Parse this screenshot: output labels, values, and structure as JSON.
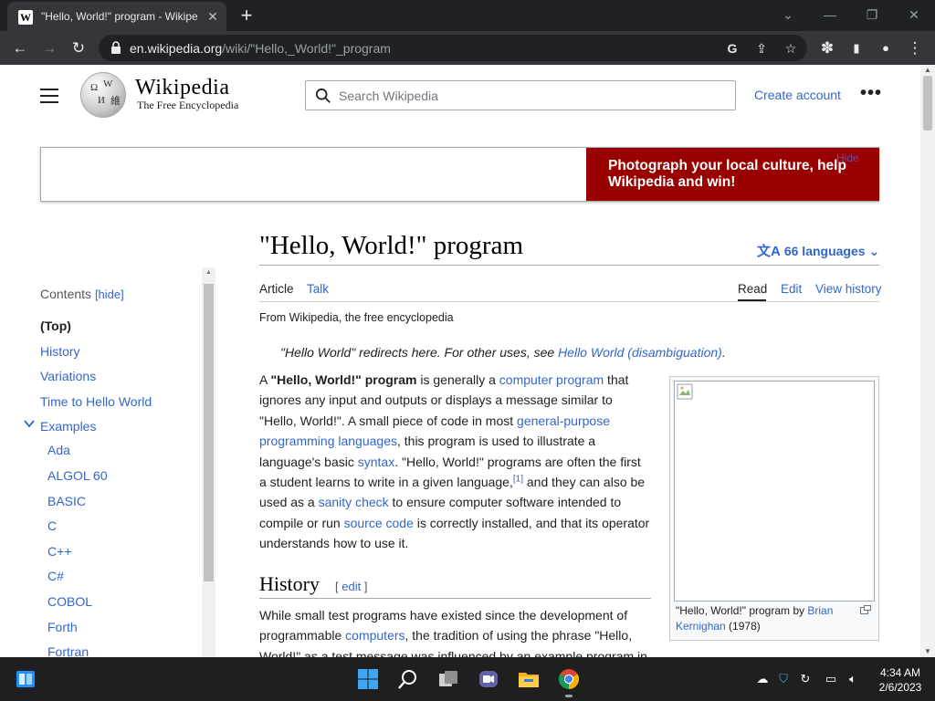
{
  "browser": {
    "tab_title": "\"Hello, World!\" program - Wikipe",
    "tab_favicon": "W",
    "url_host": "en.wikipedia.org",
    "url_path": "/wiki/\"Hello,_World!\"_program"
  },
  "icons": {
    "back": "←",
    "forward": "→",
    "reload": "↻",
    "new_tab": "+",
    "close_tab": "✕",
    "minimize": "—",
    "restore": "❐",
    "close_window": "✕",
    "tab_search": "⌄",
    "share": "⇪",
    "bookmark": "☆",
    "extensions": "✽",
    "side_panel": "▮",
    "profile": "●",
    "menu": "⋮",
    "google_lens": "G"
  },
  "wiki_header": {
    "wordmark": "Wikipedia",
    "tagline": "The Free Encyclopedia",
    "search_placeholder": "Search Wikipedia",
    "create_account": "Create account",
    "more": "•••"
  },
  "banner": {
    "text": "Photograph your local culture, help Wikipedia and win!",
    "hide": "Hide"
  },
  "toc": {
    "title": "Contents",
    "hide": "[hide]",
    "items": [
      {
        "label": "(Top)"
      },
      {
        "label": "History"
      },
      {
        "label": "Variations"
      },
      {
        "label": "Time to Hello World"
      },
      {
        "label": "Examples"
      },
      {
        "label": "Ada"
      },
      {
        "label": "ALGOL 60"
      },
      {
        "label": "BASIC"
      },
      {
        "label": "C"
      },
      {
        "label": "C++"
      },
      {
        "label": "C#"
      },
      {
        "label": "COBOL"
      },
      {
        "label": "Forth"
      },
      {
        "label": "Fortran"
      }
    ]
  },
  "article": {
    "title": "\"Hello, World!\" program",
    "languages": "66 languages",
    "tabs": {
      "article": "Article",
      "talk": "Talk",
      "read": "Read",
      "edit": "Edit",
      "history": "View history"
    },
    "from": "From Wikipedia, the free encyclopedia",
    "hatnote_text": "\"Hello World\" redirects here. For other uses, see ",
    "hatnote_link": "Hello World (disambiguation)",
    "hatnote_end": ".",
    "p1": {
      "a": "A ",
      "b": "\"Hello, World!\" program",
      "c": " is generally a ",
      "link1": "computer program",
      "d": " that",
      "l2": "ignores any input and outputs or displays a message similar to",
      "l3a": "\"Hello, World!\". A small piece of code in most ",
      "link2a": "general-purpose",
      "link2b": "programming languages",
      "l4b": ", this program is used to illustrate a",
      "l5a": "language's basic ",
      "link3": "syntax",
      "l5b": ". \"Hello, World!\" programs are often the first",
      "l6a": "a student learns to write in a given language,",
      "ref": "[1]",
      "l6b": " and they can also be",
      "l7a": "used as a ",
      "link4": "sanity check",
      "l7b": " to ensure computer software intended to",
      "l8a": "compile or run ",
      "link5": "source code",
      "l8b": " is correctly installed, and that its operator",
      "l9": "understands how to use it."
    },
    "history_heading": "History",
    "history_edit_open": "[ ",
    "history_edit": "edit",
    "history_edit_close": " ]",
    "p2": {
      "l1": "While small test programs have existed since the development of",
      "l2a": "programmable ",
      "link1": "computers",
      "l2b": ", the tradition of using the phrase \"Hello,",
      "l3": "World!\" as a test message was influenced by an example program in"
    },
    "thumb_caption_a": "\"Hello, World!\" program by ",
    "thumb_caption_link": "Brian Kernighan",
    "thumb_caption_b": " (1978)"
  },
  "taskbar": {
    "time": "4:34 AM",
    "date": "2/6/2023"
  },
  "colors": {
    "link": "#3366cc",
    "banner_red": "#990000",
    "chrome_dark": "#202124",
    "chrome_toolbar": "#35363a",
    "taskbar": "#1f1f1f"
  }
}
